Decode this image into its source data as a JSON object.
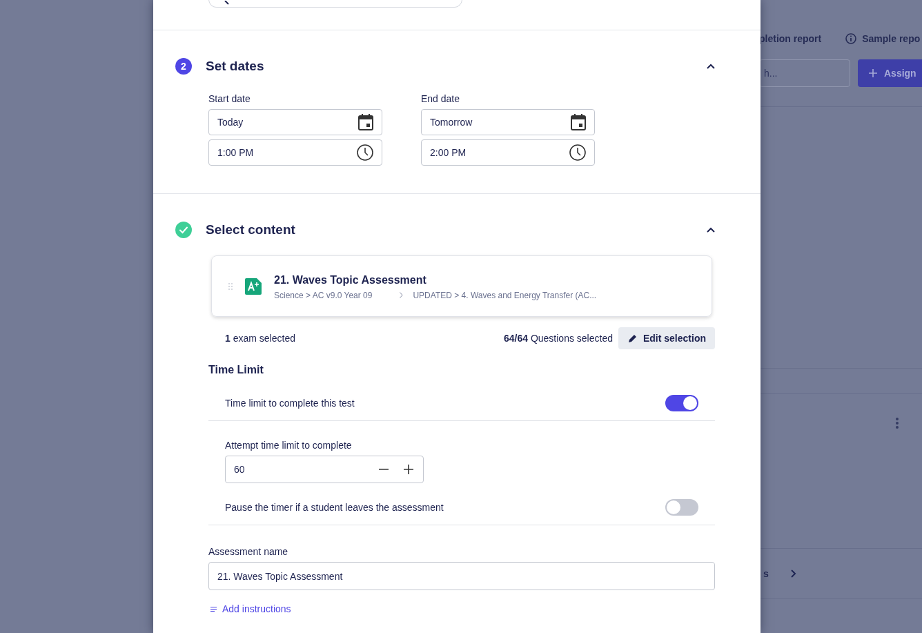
{
  "background": {
    "links": [
      {
        "label": "pletion report",
        "icon": false
      },
      {
        "label": "Sample repo",
        "icon": true
      }
    ],
    "search": {
      "placeholder": "h..."
    },
    "assign_button": "Assign",
    "list_item_text": "s"
  },
  "set_dates": {
    "step": "2",
    "done": false,
    "title": "Set dates",
    "expanded": true,
    "start": {
      "label": "Start date",
      "date": "Today",
      "time": "1:00 PM"
    },
    "end": {
      "label": "End date",
      "date": "Tomorrow",
      "time": "2:00 PM"
    }
  },
  "select_content": {
    "done": true,
    "title": "Select content",
    "expanded": true,
    "exam": {
      "title": "21. Waves Topic Assessment",
      "path_1": "Science > AC v9.0 Year 09",
      "path_2": "UPDATED > 4. Waves and Energy Transfer (AC..."
    },
    "exam_summary": "**1** exam selected",
    "questions_summary": "**64/64** Questions selected",
    "edit_button": "Edit selection"
  },
  "time_limit": {
    "heading": "Time Limit",
    "items": [
      {
        "kind": "toggle",
        "label": "Time limit to complete this test",
        "on": true
      },
      {
        "kind": "stepper",
        "label": "Attempt time limit to complete",
        "value": "60"
      },
      {
        "kind": "toggle",
        "label": "Pause the timer if a student leaves the assessment",
        "on": false
      }
    ]
  },
  "assessment_name": {
    "label": "Assessment name",
    "value": "21. Waves Topic Assessment"
  },
  "add_instructions": "Add instructions"
}
